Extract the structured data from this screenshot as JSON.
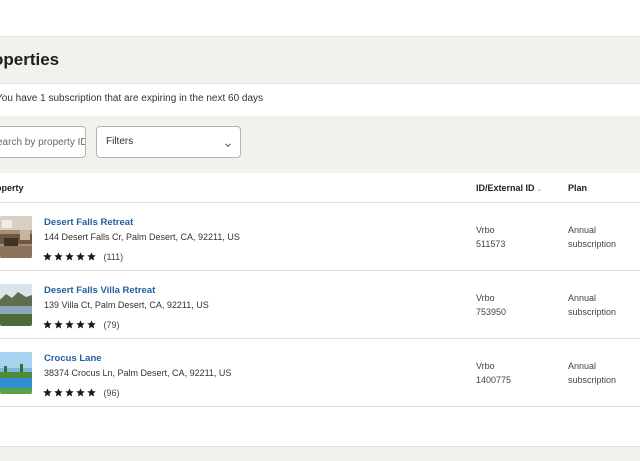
{
  "header": {
    "title": "operties"
  },
  "notice": "You have 1 subscription that are expiring in the next 60 days",
  "search": {
    "placeholder": "earch by property ID"
  },
  "filters": {
    "label": "Filters"
  },
  "table": {
    "columns": {
      "property": "operty",
      "id": "ID/External ID",
      "plan": "Plan"
    },
    "rows": [
      {
        "name": "Desert Falls Retreat",
        "address": "144 Desert Falls Cr, Palm Desert, CA, 92211, US",
        "stars": 5,
        "reviews": "(111)",
        "channel": "Vrbo",
        "id": "511573",
        "plan_line1": "Annual",
        "plan_line2": "subscription"
      },
      {
        "name": "Desert Falls Villa Retreat",
        "address": "139 Villa Ct, Palm Desert, CA, 92211, US",
        "stars": 5,
        "reviews": "(79)",
        "channel": "Vrbo",
        "id": "753950",
        "plan_line1": "Annual",
        "plan_line2": "subscription"
      },
      {
        "name": "Crocus Lane",
        "address": "38374 Crocus Ln, Palm Desert, CA, 92211, US",
        "stars": 5,
        "reviews": "(96)",
        "channel": "Vrbo",
        "id": "1400775",
        "plan_line1": "Annual",
        "plan_line2": "subscription"
      }
    ]
  },
  "colors": {
    "link": "#1f5f9e",
    "band": "#f3f1ee",
    "star": "#1a1a1a"
  },
  "icons": {
    "sort": "sort-icon",
    "dropdown": "chevron-down-icon",
    "star": "star-icon"
  }
}
